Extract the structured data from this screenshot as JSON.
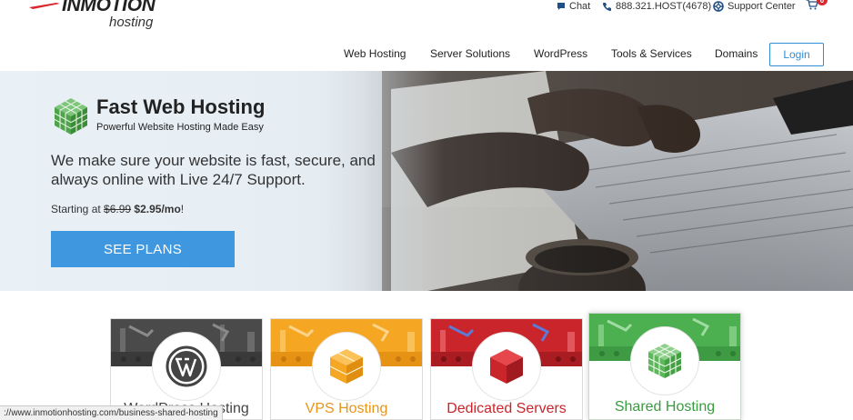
{
  "brand": {
    "logo_main": "INMOTION",
    "logo_sub": "hosting",
    "accent": "#3f97df",
    "red": "#d9272e"
  },
  "utility": {
    "chat": "Chat",
    "phone": "888.321.HOST(4678)",
    "support": "Support Center",
    "cart_count": "0"
  },
  "nav": {
    "items": [
      "Web Hosting",
      "Server Solutions",
      "WordPress",
      "Tools & Services",
      "Domains"
    ],
    "login": "Login"
  },
  "hero": {
    "title": "Fast Web Hosting",
    "subtitle": "Powerful Website Hosting Made Easy",
    "description": "We make sure your website is fast, secure, and always online with Live 24/7 Support.",
    "price_prefix": "Starting at",
    "price_old": "$6.99",
    "price_new": "$2.95/mo",
    "price_suffix": "!",
    "cta": "SEE PLANS"
  },
  "cards": [
    {
      "title": "WordPress Hosting",
      "color": "#4a4a4a",
      "icon": "wordpress-icon",
      "title_color": "#444444"
    },
    {
      "title": "VPS Hosting",
      "color": "#f5a623",
      "icon": "vps-cube-icon",
      "title_color": "#e8951a"
    },
    {
      "title": "Dedicated Servers",
      "color": "#c9252b",
      "icon": "dedicated-cube-icon",
      "title_color": "#c9252b"
    },
    {
      "title": "Shared Hosting",
      "color": "#4caf50",
      "icon": "shared-cube-icon",
      "title_color": "#3a9a40"
    }
  ],
  "status_bar": {
    "url": "://www.inmotionhosting.com/business-shared-hosting"
  }
}
